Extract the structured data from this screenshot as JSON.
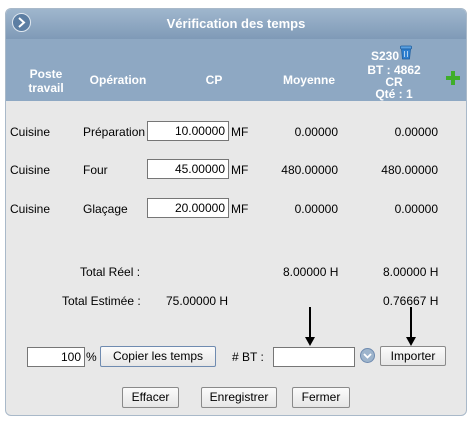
{
  "title": "Vérification des temps",
  "columns": {
    "poste_travail": "Poste\ntravail",
    "operation": "Opération",
    "cp": "CP",
    "moyenne": "Moyenne",
    "s230": "S230",
    "bt": "BT : 4862",
    "cr": "CR",
    "qte": "Qté : 1"
  },
  "rows": [
    {
      "poste": "Cuisine",
      "operation": "Préparation",
      "cp_value": "10.00000",
      "unit": "MF",
      "moyenne": "0.00000",
      "s230": "0.00000"
    },
    {
      "poste": "Cuisine",
      "operation": "Four",
      "cp_value": "45.00000",
      "unit": "MF",
      "moyenne": "480.00000",
      "s230": "480.00000"
    },
    {
      "poste": "Cuisine",
      "operation": "Glaçage",
      "cp_value": "20.00000",
      "unit": "MF",
      "moyenne": "0.00000",
      "s230": "0.00000"
    }
  ],
  "totals": {
    "reel_label": "Total Réel :",
    "reel_moyenne": "8.00000 H",
    "reel_s230": "8.00000 H",
    "estimee_label": "Total Estimée :",
    "estimee_cp": "75.00000 H",
    "estimee_s230": "0.76667 H"
  },
  "controls": {
    "percent_value": "100",
    "percent_sign": "%",
    "copy_button": "Copier les temps",
    "bt_label": "# BT :",
    "bt_value": "",
    "import_button": "Importer"
  },
  "footer": {
    "clear_button": "Effacer",
    "save_button": "Enregistrer",
    "close_button": "Fermer"
  },
  "colors": {
    "header_bg": "#8ea8c3",
    "plus_icon": "#3fae2a",
    "trash_icon": "#2d7fd0"
  }
}
